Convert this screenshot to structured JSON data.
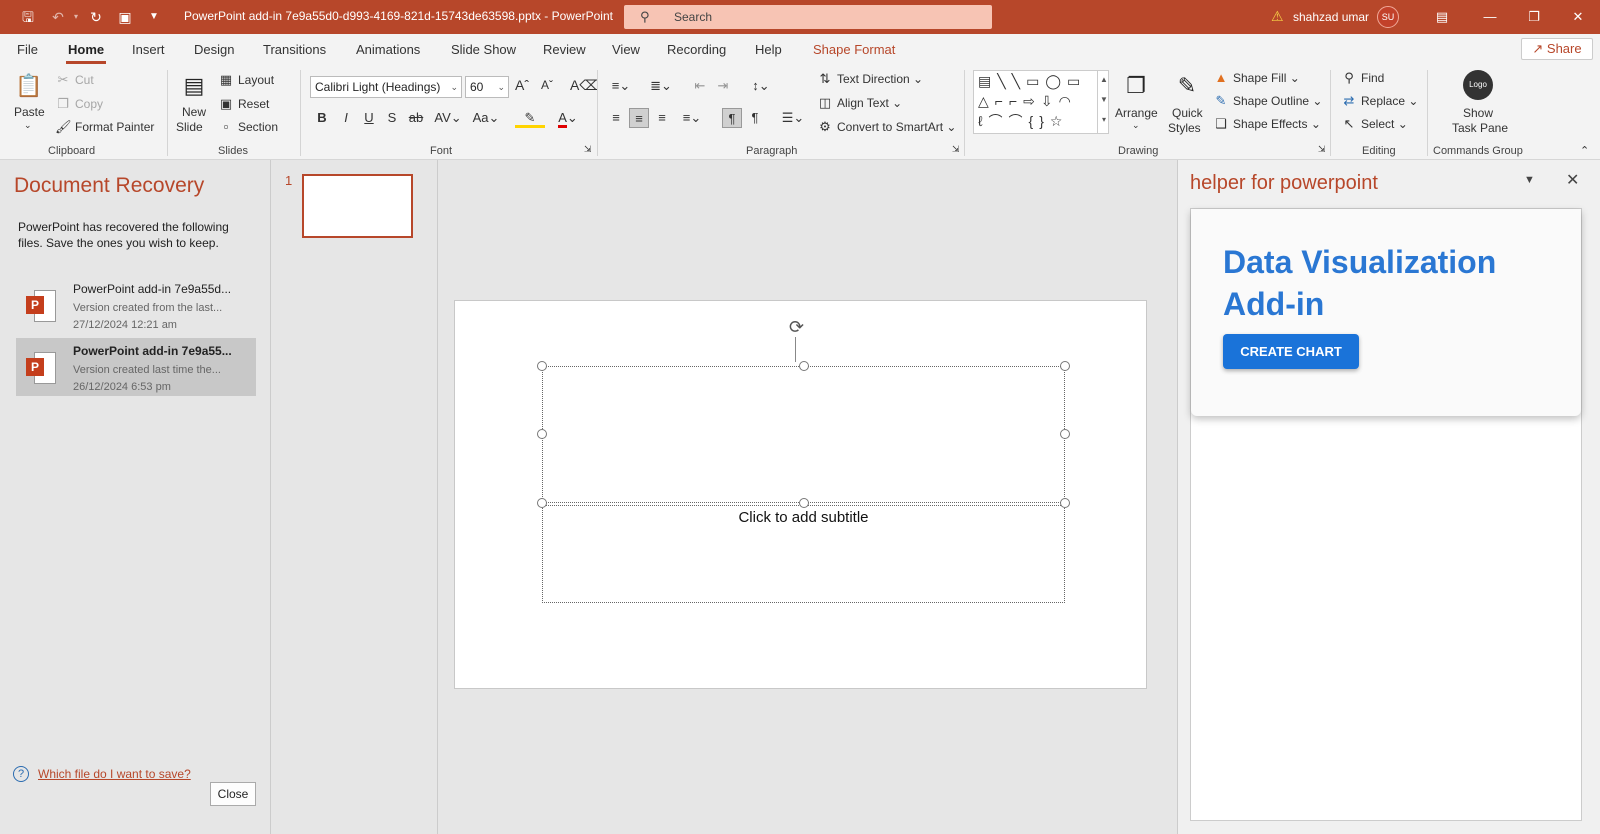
{
  "titlebar": {
    "doc_title": "PowerPoint add-in 7e9a55d0-d993-4169-821d-15743de63598.pptx  -  PowerPoint",
    "search_placeholder": "Search",
    "user_name": "shahzad umar",
    "user_initials": "SU"
  },
  "menu": {
    "tabs": [
      "File",
      "Home",
      "Insert",
      "Design",
      "Transitions",
      "Animations",
      "Slide Show",
      "Review",
      "View",
      "Recording",
      "Help",
      "Shape Format"
    ],
    "active_tab": "Home",
    "share_label": "Share"
  },
  "ribbon": {
    "clipboard": {
      "paste": "Paste",
      "cut": "Cut",
      "copy": "Copy",
      "format_painter": "Format Painter",
      "label": "Clipboard"
    },
    "slides": {
      "new_slide_1": "New",
      "new_slide_2": "Slide",
      "layout": "Layout",
      "reset": "Reset",
      "section": "Section",
      "label": "Slides"
    },
    "font": {
      "font_name": "Calibri Light (Headings)",
      "font_size": "60",
      "label": "Font"
    },
    "paragraph": {
      "text_direction": "Text Direction",
      "align_text": "Align Text",
      "convert_smartart": "Convert to SmartArt",
      "label": "Paragraph"
    },
    "drawing": {
      "arrange": "Arrange",
      "quick_styles_1": "Quick",
      "quick_styles_2": "Styles",
      "shape_fill": "Shape Fill",
      "shape_outline": "Shape Outline",
      "shape_effects": "Shape Effects",
      "label": "Drawing"
    },
    "editing": {
      "find": "Find",
      "replace": "Replace",
      "select": "Select",
      "label": "Editing"
    },
    "commands": {
      "logo": "Logo",
      "show_1": "Show",
      "show_2": "Task Pane",
      "label": "Commands Group"
    }
  },
  "recovery": {
    "title": "Document Recovery",
    "description": "PowerPoint has recovered the following files.  Save the ones you wish to keep.",
    "items": [
      {
        "name": "PowerPoint add-in 7e9a55d...",
        "sub": "Version created from the last...",
        "date": "27/12/2024 12:21 am"
      },
      {
        "name": "PowerPoint add-in 7e9a55...",
        "sub": "Version created last time the...",
        "date": "26/12/2024 6:53 pm"
      }
    ],
    "help_link": "Which file do I want to save?",
    "close_label": "Close"
  },
  "thumbnails": {
    "slide_number": "1"
  },
  "slide": {
    "subtitle_placeholder": "Click to add subtitle"
  },
  "taskpane": {
    "title": "helper for powerpoint",
    "heading": "Data Visualization Add-in",
    "button": "CREATE CHART"
  },
  "colors": {
    "accent": "#b7472a",
    "addin_blue": "#1a73d9"
  }
}
